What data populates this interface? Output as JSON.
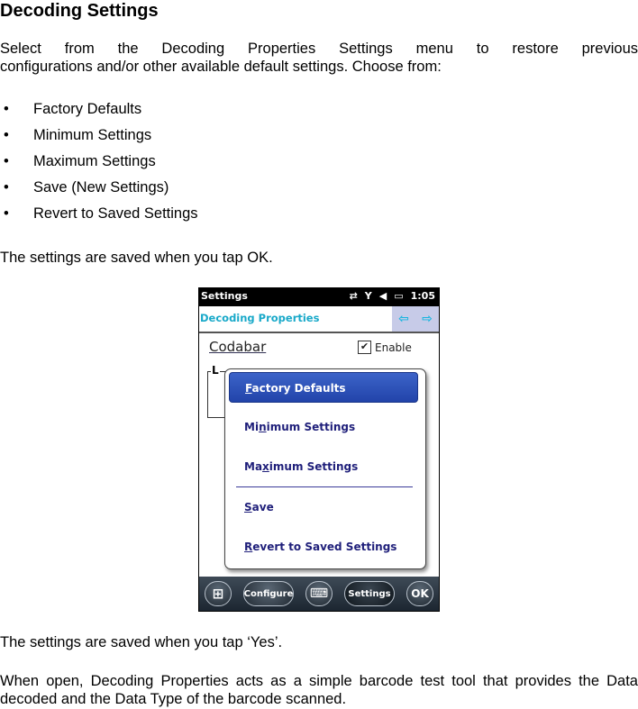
{
  "heading": "Decoding Settings",
  "intro_line1": "Select from the Decoding Properties Settings menu to restore previous",
  "intro_line2": "configurations and/or other available default settings. Choose from:",
  "bullets": [
    "Factory Defaults",
    "Minimum Settings",
    "Maximum Settings",
    "Save (New Settings)",
    "Revert to Saved Settings"
  ],
  "bullet_glyph": "•",
  "saved_ok": "The settings are saved when you tap OK.",
  "saved_yes": "The settings are saved when you tap ‘Yes’.",
  "final_para": "When open, Decoding Properties acts as a simple barcode test tool that provides the Data decoded and the Data Type of the barcode scanned.",
  "device": {
    "status_bar": {
      "title": "Settings",
      "sync_icon": "⇄",
      "signal_icon": "Y",
      "volume_icon": "◀",
      "battery_icon": "▭",
      "time": "1:05"
    },
    "title_bar": {
      "title": "Decoding Properties",
      "back_arrow": "⇦",
      "forward_arrow": "⇨"
    },
    "symbology": "Codabar",
    "enable_label": "Enable",
    "enable_checked": true,
    "check_glyph": "✔",
    "group_label": "L",
    "menu": {
      "items": [
        {
          "accel": "F",
          "rest": "actory Defaults",
          "pre": ""
        },
        {
          "pre": "Mi",
          "accel": "n",
          "rest": "imum Settings"
        },
        {
          "pre": "Ma",
          "accel": "x",
          "rest": "imum Settings"
        },
        {
          "pre": "",
          "accel": "S",
          "rest": "ave"
        },
        {
          "pre": "",
          "accel": "R",
          "rest": "evert to Saved Settings"
        }
      ],
      "selected_index": 0
    },
    "taskbar": {
      "start_icon": "⊞",
      "configure": "Configure",
      "keyboard_icon": "⌨",
      "settings": "Settings",
      "ok": "OK"
    }
  }
}
